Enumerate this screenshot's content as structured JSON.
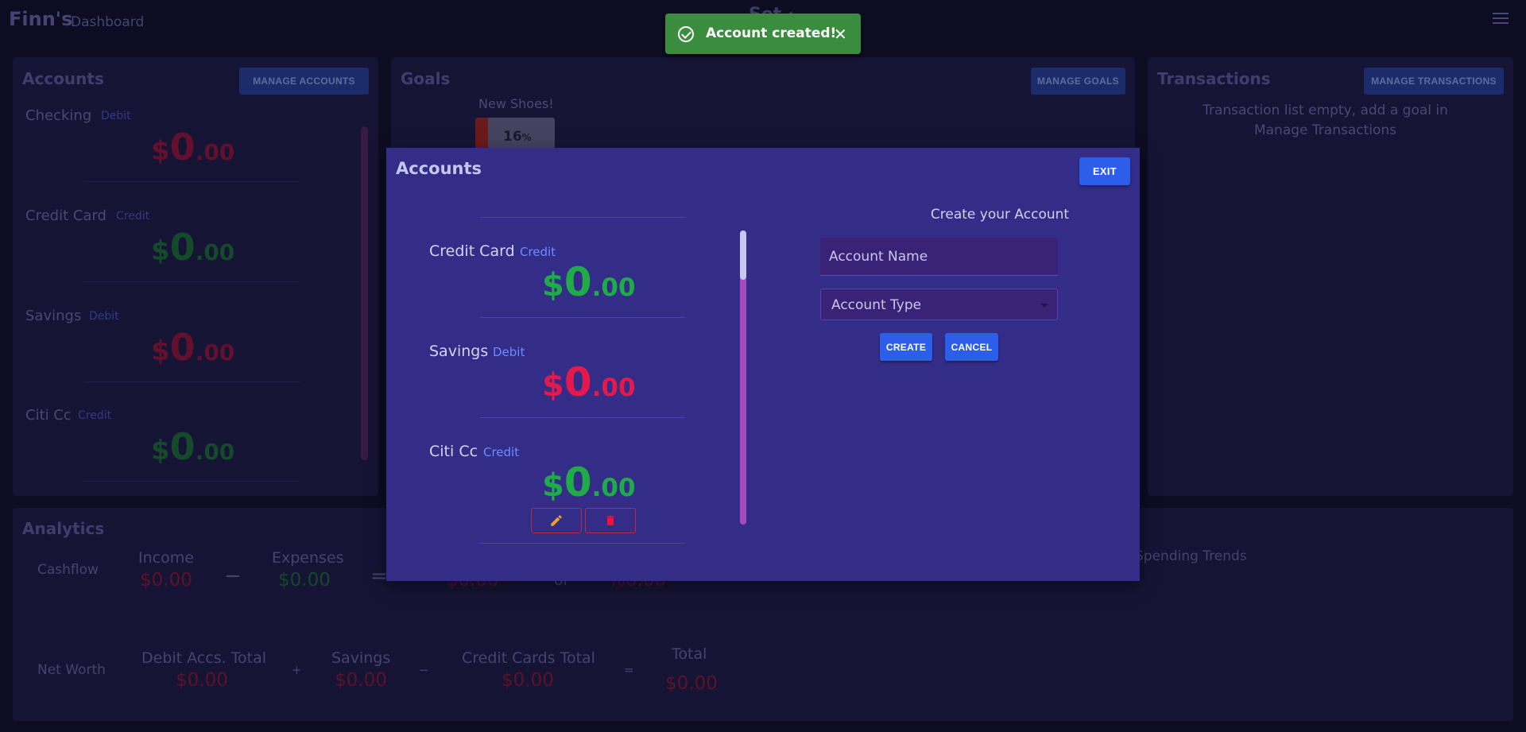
{
  "header": {
    "brand": "Finn's",
    "subtitle": "Dashboard",
    "center_title": "Set ·"
  },
  "accounts_panel": {
    "title": "Accounts",
    "manage_label": "MANAGE ACCOUNTS",
    "items": [
      {
        "name": "Checking",
        "type": "Debit",
        "currency": "$",
        "whole": "0",
        "cents": ".00",
        "color": "red"
      },
      {
        "name": "Credit Card",
        "type": "Credit",
        "currency": "$",
        "whole": "0",
        "cents": ".00",
        "color": "green"
      },
      {
        "name": "Savings",
        "type": "Debit",
        "currency": "$",
        "whole": "0",
        "cents": ".00",
        "color": "red"
      },
      {
        "name": "Citi Cc",
        "type": "Credit",
        "currency": "$",
        "whole": "0",
        "cents": ".00",
        "color": "green"
      }
    ]
  },
  "goals_panel": {
    "title": "Goals",
    "manage_label": "MANAGE GOALS",
    "goal_name": "New Shoes!",
    "goal_percent": "16",
    "goal_percent_sign": "%",
    "goal_progress": 0.16
  },
  "transactions_panel": {
    "title": "Transactions",
    "manage_label": "MANAGE TRANSACTIONS",
    "empty_text": "Transaction list empty, add a goal in Manage Transactions"
  },
  "analytics": {
    "title": "Analytics",
    "cashflow": {
      "label": "Cashflow",
      "income_label": "Income",
      "income_value": "$0.00",
      "minus": "−",
      "expenses_label": "Expenses",
      "expenses_value": "$0.00",
      "equals": "=",
      "result_value": "$0.00",
      "or": "or",
      "percent_value": "%0.00"
    },
    "spending_trends": "Spending Trends",
    "net_worth": {
      "label": "Net Worth",
      "debit_label": "Debit Accs. Total",
      "debit_value": "$0.00",
      "plus": "+",
      "savings_label": "Savings",
      "savings_value": "$0.00",
      "minus": "−",
      "credit_label": "Credit Cards Total",
      "credit_value": "$0.00",
      "equals": "=",
      "total_label": "Total",
      "total_value": "$0.00"
    }
  },
  "toast": {
    "message": "Account created!",
    "close": "✕",
    "color": "#3a8c3f"
  },
  "modal": {
    "title": "Accounts",
    "exit_label": "EXIT",
    "accounts": [
      {
        "name": "Credit Card",
        "type": "Credit",
        "currency": "$",
        "whole": "0",
        "cents": ".00",
        "color": "green"
      },
      {
        "name": "Savings",
        "type": "Debit",
        "currency": "$",
        "whole": "0",
        "cents": ".00",
        "color": "red"
      },
      {
        "name": "Citi Cc",
        "type": "Credit",
        "currency": "$",
        "whole": "0",
        "cents": ".00",
        "color": "green"
      }
    ],
    "edit_icon": "pencil-icon",
    "delete_icon": "trash-icon",
    "form": {
      "title": "Create your Account",
      "name_placeholder": "Account Name",
      "type_placeholder": "Account Type",
      "create_label": "CREATE",
      "cancel_label": "CANCEL"
    }
  },
  "colors": {
    "accent": "#2d5ee9",
    "modal_bg": "#332d88",
    "positive": "#1fab47",
    "negative": "#e4194b",
    "page_bg": "#0d0c22"
  }
}
